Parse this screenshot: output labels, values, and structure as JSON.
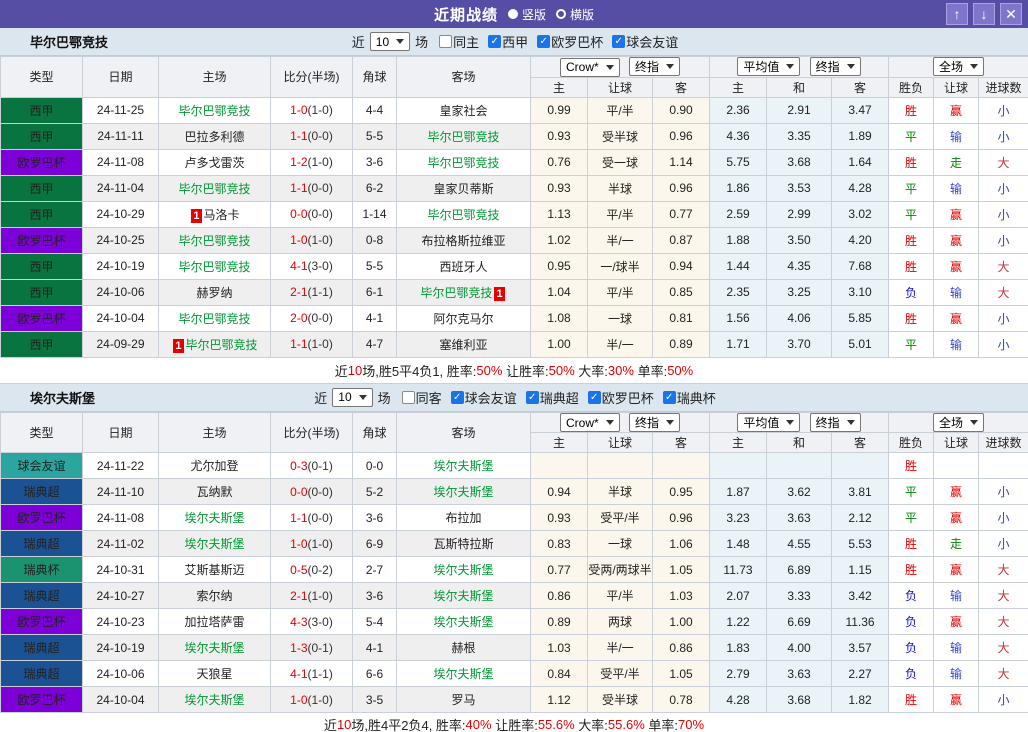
{
  "titlebar": {
    "title": "近期战绩",
    "radios": [
      {
        "label": "竖版",
        "selected": true
      },
      {
        "label": "横版",
        "selected": false
      }
    ]
  },
  "icons": {
    "up": "↑",
    "down": "↓",
    "close": "✕",
    "check": "✓"
  },
  "columns": {
    "type": "类型",
    "date": "日期",
    "home": "主场",
    "score": "比分(半场)",
    "corner": "角球",
    "away": "客场",
    "sub": [
      "主",
      "让球",
      "客",
      "主",
      "和",
      "客",
      "胜负",
      "让球",
      "进球数"
    ]
  },
  "dropdowns": {
    "crow": "Crow*",
    "final1": "终指",
    "avg": "平均值",
    "final2": "终指",
    "scope": "全场"
  },
  "league_colors": {
    "西甲": "#0A7440",
    "欧罗巴杯": "#7D00D8",
    "球会友谊": "#2AA5A0",
    "瑞典超": "#1A5293",
    "瑞典杯": "#1B9370"
  },
  "result_colors": {
    "胜": "#E00000",
    "平": "#008800",
    "负": "#1111CC",
    "赢": "#E00000",
    "输": "#3344CC",
    "走": "#008800",
    "大": "#CC3333",
    "小": "#3344CC"
  },
  "accent_colors": {
    "titlebar": "#564EA4",
    "band": "#DCE6EE",
    "checkbox": "#1A73E8",
    "score_red": "#E60000",
    "team_green": "#009933"
  },
  "sections": [
    {
      "team": "毕尔巴鄂竞技",
      "filters": {
        "near": "近",
        "count": "10",
        "games": "场",
        "same": {
          "label": "同主",
          "checked": false
        },
        "leagues": [
          {
            "label": "西甲",
            "checked": true
          },
          {
            "label": "欧罗巴杯",
            "checked": true
          },
          {
            "label": "球会友谊",
            "checked": true
          }
        ]
      },
      "rows": [
        {
          "league": "西甲",
          "date": "24-11-25",
          "home": "毕尔巴鄂竞技",
          "home_green": true,
          "home_card": "",
          "score": "1-0",
          "half": "(1-0)",
          "corner": "4-4",
          "away": "皇家社会",
          "away_green": false,
          "away_card": "",
          "crow": [
            "0.99",
            "平/半",
            "0.90"
          ],
          "avg": [
            "2.36",
            "2.91",
            "3.47"
          ],
          "result": [
            "胜",
            "赢",
            "小"
          ]
        },
        {
          "league": "西甲",
          "date": "24-11-11",
          "home": "巴拉多利德",
          "home_green": false,
          "home_card": "",
          "score": "1-1",
          "half": "(0-0)",
          "corner": "5-5",
          "away": "毕尔巴鄂竞技",
          "away_green": true,
          "away_card": "",
          "crow": [
            "0.93",
            "受半球",
            "0.96"
          ],
          "avg": [
            "4.36",
            "3.35",
            "1.89"
          ],
          "result": [
            "平",
            "输",
            "小"
          ]
        },
        {
          "league": "欧罗巴杯",
          "date": "24-11-08",
          "home": "卢多戈雷茨",
          "home_green": false,
          "home_card": "",
          "score": "1-2",
          "half": "(1-0)",
          "corner": "3-6",
          "away": "毕尔巴鄂竞技",
          "away_green": true,
          "away_card": "",
          "crow": [
            "0.76",
            "受一球",
            "1.14"
          ],
          "avg": [
            "5.75",
            "3.68",
            "1.64"
          ],
          "result": [
            "胜",
            "走",
            "大"
          ]
        },
        {
          "league": "西甲",
          "date": "24-11-04",
          "home": "毕尔巴鄂竞技",
          "home_green": true,
          "home_card": "",
          "score": "1-1",
          "half": "(0-0)",
          "corner": "6-2",
          "away": "皇家贝蒂斯",
          "away_green": false,
          "away_card": "",
          "crow": [
            "0.93",
            "半球",
            "0.96"
          ],
          "avg": [
            "1.86",
            "3.53",
            "4.28"
          ],
          "result": [
            "平",
            "输",
            "小"
          ]
        },
        {
          "league": "西甲",
          "date": "24-10-29",
          "home": "马洛卡",
          "home_green": false,
          "home_card": "1",
          "score": "0-0",
          "half": "(0-0)",
          "corner": "1-14",
          "away": "毕尔巴鄂竞技",
          "away_green": true,
          "away_card": "",
          "crow": [
            "1.13",
            "平/半",
            "0.77"
          ],
          "avg": [
            "2.59",
            "2.99",
            "3.02"
          ],
          "result": [
            "平",
            "赢",
            "小"
          ]
        },
        {
          "league": "欧罗巴杯",
          "date": "24-10-25",
          "home": "毕尔巴鄂竞技",
          "home_green": true,
          "home_card": "",
          "score": "1-0",
          "half": "(1-0)",
          "corner": "0-8",
          "away": "布拉格斯拉维亚",
          "away_green": false,
          "away_card": "",
          "crow": [
            "1.02",
            "半/一",
            "0.87"
          ],
          "avg": [
            "1.88",
            "3.50",
            "4.20"
          ],
          "result": [
            "胜",
            "赢",
            "小"
          ]
        },
        {
          "league": "西甲",
          "date": "24-10-19",
          "home": "毕尔巴鄂竞技",
          "home_green": true,
          "home_card": "",
          "score": "4-1",
          "half": "(3-0)",
          "corner": "5-5",
          "away": "西班牙人",
          "away_green": false,
          "away_card": "",
          "crow": [
            "0.95",
            "一/球半",
            "0.94"
          ],
          "avg": [
            "1.44",
            "4.35",
            "7.68"
          ],
          "result": [
            "胜",
            "赢",
            "大"
          ]
        },
        {
          "league": "西甲",
          "date": "24-10-06",
          "home": "赫罗纳",
          "home_green": false,
          "home_card": "",
          "score": "2-1",
          "half": "(1-1)",
          "corner": "6-1",
          "away": "毕尔巴鄂竞技",
          "away_green": true,
          "away_card": "1",
          "crow": [
            "1.04",
            "平/半",
            "0.85"
          ],
          "avg": [
            "2.35",
            "3.25",
            "3.10"
          ],
          "result": [
            "负",
            "输",
            "大"
          ]
        },
        {
          "league": "欧罗巴杯",
          "date": "24-10-04",
          "home": "毕尔巴鄂竞技",
          "home_green": true,
          "home_card": "",
          "score": "2-0",
          "half": "(0-0)",
          "corner": "4-1",
          "away": "阿尔克马尔",
          "away_green": false,
          "away_card": "",
          "crow": [
            "1.08",
            "一球",
            "0.81"
          ],
          "avg": [
            "1.56",
            "4.06",
            "5.85"
          ],
          "result": [
            "胜",
            "赢",
            "小"
          ]
        },
        {
          "league": "西甲",
          "date": "24-09-29",
          "home": "毕尔巴鄂竞技",
          "home_green": true,
          "home_card": "1",
          "score": "1-1",
          "half": "(1-0)",
          "corner": "4-7",
          "away": "塞维利亚",
          "away_green": false,
          "away_card": "",
          "crow": [
            "1.00",
            "半/一",
            "0.89"
          ],
          "avg": [
            "1.71",
            "3.70",
            "5.01"
          ],
          "result": [
            "平",
            "输",
            "小"
          ]
        }
      ],
      "summary": [
        {
          "t": "近"
        },
        {
          "t": "10",
          "red": true
        },
        {
          "t": "场,胜5平4负1, 胜率:"
        },
        {
          "t": "50%",
          "red": true
        },
        {
          "t": " 让胜率:"
        },
        {
          "t": "50%",
          "red": true
        },
        {
          "t": " 大率:"
        },
        {
          "t": "30%",
          "red": true
        },
        {
          "t": " 单率:"
        },
        {
          "t": "50%",
          "red": true
        }
      ]
    },
    {
      "team": "埃尔夫斯堡",
      "filters": {
        "near": "近",
        "count": "10",
        "games": "场",
        "same": {
          "label": "同客",
          "checked": false
        },
        "leagues": [
          {
            "label": "球会友谊",
            "checked": true
          },
          {
            "label": "瑞典超",
            "checked": true
          },
          {
            "label": "欧罗巴杯",
            "checked": true
          },
          {
            "label": "瑞典杯",
            "checked": true
          }
        ]
      },
      "rows": [
        {
          "league": "球会友谊",
          "date": "24-11-22",
          "home": "尤尔加登",
          "home_green": false,
          "home_card": "",
          "score": "0-3",
          "half": "(0-1)",
          "corner": "0-0",
          "away": "埃尔夫斯堡",
          "away_green": true,
          "away_card": "",
          "crow": [
            "",
            "",
            ""
          ],
          "avg": [
            "",
            "",
            ""
          ],
          "result": [
            "胜",
            "",
            ""
          ]
        },
        {
          "league": "瑞典超",
          "date": "24-11-10",
          "home": "瓦纳默",
          "home_green": false,
          "home_card": "",
          "score": "0-0",
          "half": "(0-0)",
          "corner": "5-2",
          "away": "埃尔夫斯堡",
          "away_green": true,
          "away_card": "",
          "crow": [
            "0.94",
            "半球",
            "0.95"
          ],
          "avg": [
            "1.87",
            "3.62",
            "3.81"
          ],
          "result": [
            "平",
            "赢",
            "小"
          ]
        },
        {
          "league": "欧罗巴杯",
          "date": "24-11-08",
          "home": "埃尔夫斯堡",
          "home_green": true,
          "home_card": "",
          "score": "1-1",
          "half": "(0-0)",
          "corner": "3-6",
          "away": "布拉加",
          "away_green": false,
          "away_card": "",
          "crow": [
            "0.93",
            "受平/半",
            "0.96"
          ],
          "avg": [
            "3.23",
            "3.63",
            "2.12"
          ],
          "result": [
            "平",
            "赢",
            "小"
          ]
        },
        {
          "league": "瑞典超",
          "date": "24-11-02",
          "home": "埃尔夫斯堡",
          "home_green": true,
          "home_card": "",
          "score": "1-0",
          "half": "(1-0)",
          "corner": "6-9",
          "away": "瓦斯特拉斯",
          "away_green": false,
          "away_card": "",
          "crow": [
            "0.83",
            "一球",
            "1.06"
          ],
          "avg": [
            "1.48",
            "4.55",
            "5.53"
          ],
          "result": [
            "胜",
            "走",
            "小"
          ]
        },
        {
          "league": "瑞典杯",
          "date": "24-10-31",
          "home": "艾斯基斯迈",
          "home_green": false,
          "home_card": "",
          "score": "0-5",
          "half": "(0-2)",
          "corner": "2-7",
          "away": "埃尔夫斯堡",
          "away_green": true,
          "away_card": "",
          "crow": [
            "0.77",
            "受两/两球半",
            "1.05"
          ],
          "avg": [
            "11.73",
            "6.89",
            "1.15"
          ],
          "result": [
            "胜",
            "赢",
            "大"
          ]
        },
        {
          "league": "瑞典超",
          "date": "24-10-27",
          "home": "索尔纳",
          "home_green": false,
          "home_card": "",
          "score": "2-1",
          "half": "(1-0)",
          "corner": "3-6",
          "away": "埃尔夫斯堡",
          "away_green": true,
          "away_card": "",
          "crow": [
            "0.86",
            "平/半",
            "1.03"
          ],
          "avg": [
            "2.07",
            "3.33",
            "3.42"
          ],
          "result": [
            "负",
            "输",
            "大"
          ]
        },
        {
          "league": "欧罗巴杯",
          "date": "24-10-23",
          "home": "加拉塔萨雷",
          "home_green": false,
          "home_card": "",
          "score": "4-3",
          "half": "(3-0)",
          "corner": "5-4",
          "away": "埃尔夫斯堡",
          "away_green": true,
          "away_card": "",
          "crow": [
            "0.89",
            "两球",
            "1.00"
          ],
          "avg": [
            "1.22",
            "6.69",
            "11.36"
          ],
          "result": [
            "负",
            "赢",
            "大"
          ]
        },
        {
          "league": "瑞典超",
          "date": "24-10-19",
          "home": "埃尔夫斯堡",
          "home_green": true,
          "home_card": "",
          "score": "1-3",
          "half": "(0-1)",
          "corner": "4-1",
          "away": "赫根",
          "away_green": false,
          "away_card": "",
          "crow": [
            "1.03",
            "半/一",
            "0.86"
          ],
          "avg": [
            "1.83",
            "4.00",
            "3.57"
          ],
          "result": [
            "负",
            "输",
            "大"
          ]
        },
        {
          "league": "瑞典超",
          "date": "24-10-06",
          "home": "天狼星",
          "home_green": false,
          "home_card": "",
          "score": "4-1",
          "half": "(1-1)",
          "corner": "6-6",
          "away": "埃尔夫斯堡",
          "away_green": true,
          "away_card": "",
          "crow": [
            "0.84",
            "受平/半",
            "1.05"
          ],
          "avg": [
            "2.79",
            "3.63",
            "2.27"
          ],
          "result": [
            "负",
            "输",
            "大"
          ]
        },
        {
          "league": "欧罗巴杯",
          "date": "24-10-04",
          "home": "埃尔夫斯堡",
          "home_green": true,
          "home_card": "",
          "score": "1-0",
          "half": "(1-0)",
          "corner": "3-5",
          "away": "罗马",
          "away_green": false,
          "away_card": "",
          "crow": [
            "1.12",
            "受半球",
            "0.78"
          ],
          "avg": [
            "4.28",
            "3.68",
            "1.82"
          ],
          "result": [
            "胜",
            "赢",
            "小"
          ]
        }
      ],
      "summary": [
        {
          "t": "近"
        },
        {
          "t": "10",
          "red": true
        },
        {
          "t": "场,胜4平2负4, 胜率:"
        },
        {
          "t": "40%",
          "red": true
        },
        {
          "t": " 让胜率:"
        },
        {
          "t": "55.6%",
          "red": true
        },
        {
          "t": " 大率:"
        },
        {
          "t": "55.6%",
          "red": true
        },
        {
          "t": " 单率:"
        },
        {
          "t": "70%",
          "red": true
        }
      ]
    }
  ]
}
